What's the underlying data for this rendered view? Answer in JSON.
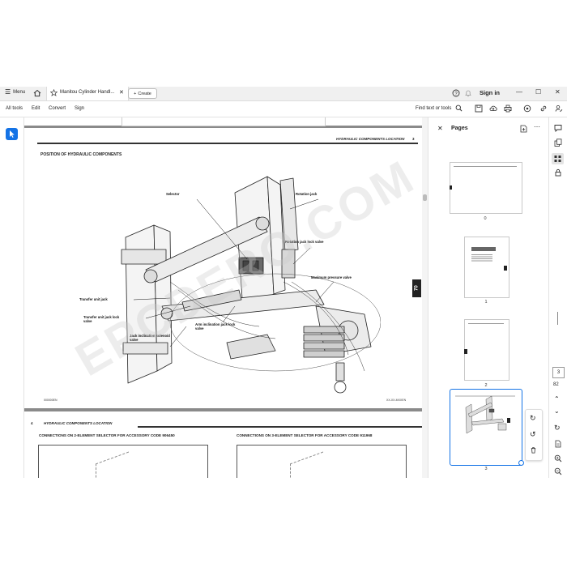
{
  "tabbar": {
    "menu_label": "Menu",
    "tab_title": "Manitou Cylinder Handl...",
    "create_label": "Create",
    "sign_in": "Sign in"
  },
  "toolbar": {
    "items": [
      "All tools",
      "Edit",
      "Convert",
      "Sign"
    ],
    "find_label": "Find text or tools"
  },
  "document": {
    "page_main": {
      "header_right": "HYDRAULIC COMPONENTS LOCATION",
      "page_number": "3",
      "title": "POSITION OF HYDRAULIC COMPONENTS",
      "labels": {
        "selector": "Selector",
        "rotation_jack": "Rotation jack",
        "rotation_jack_lock_valve": "Rotation jack lock valve",
        "maximum_pressure_valve": "Maximum pressure valve",
        "transfer_unit_jack": "Transfer unit jack",
        "transfer_unit_jack_lock_valve": "Transfer unit jack lock valve",
        "arm_inclination_jack_lock_valve": "Arm inclination jack lock valve",
        "jack_inclination_solenoid_valve": "Jack inclination solenoid valve"
      },
      "footer_left": "000000EN",
      "footer_right": "XX-XX-MXXEN",
      "side_tab": "70"
    },
    "page_next": {
      "page_number": "4",
      "header_left": "HYDRAULIC COMPONENTS LOCATION",
      "col1_title": "CONNECTIONS ON 2-ELEMENT SELECTOR FOR ACCESSORY CODE 906450",
      "col2_title": "CONNECTIONS ON 3-ELEMENT SELECTOR FOR ACCESSORY CODE 911968"
    },
    "watermark": "EPCDERO.COM"
  },
  "pages_panel": {
    "title": "Pages",
    "thumbnails": [
      {
        "label": "0"
      },
      {
        "label": "1"
      },
      {
        "label": "2"
      },
      {
        "label": "3"
      }
    ]
  },
  "right_rail": {
    "current_page": "3",
    "total_pages": "82"
  },
  "colors": {
    "accent": "#1473e6",
    "selected_thumb_border": "#1473e6",
    "doc_background": "#8a8a8a"
  }
}
